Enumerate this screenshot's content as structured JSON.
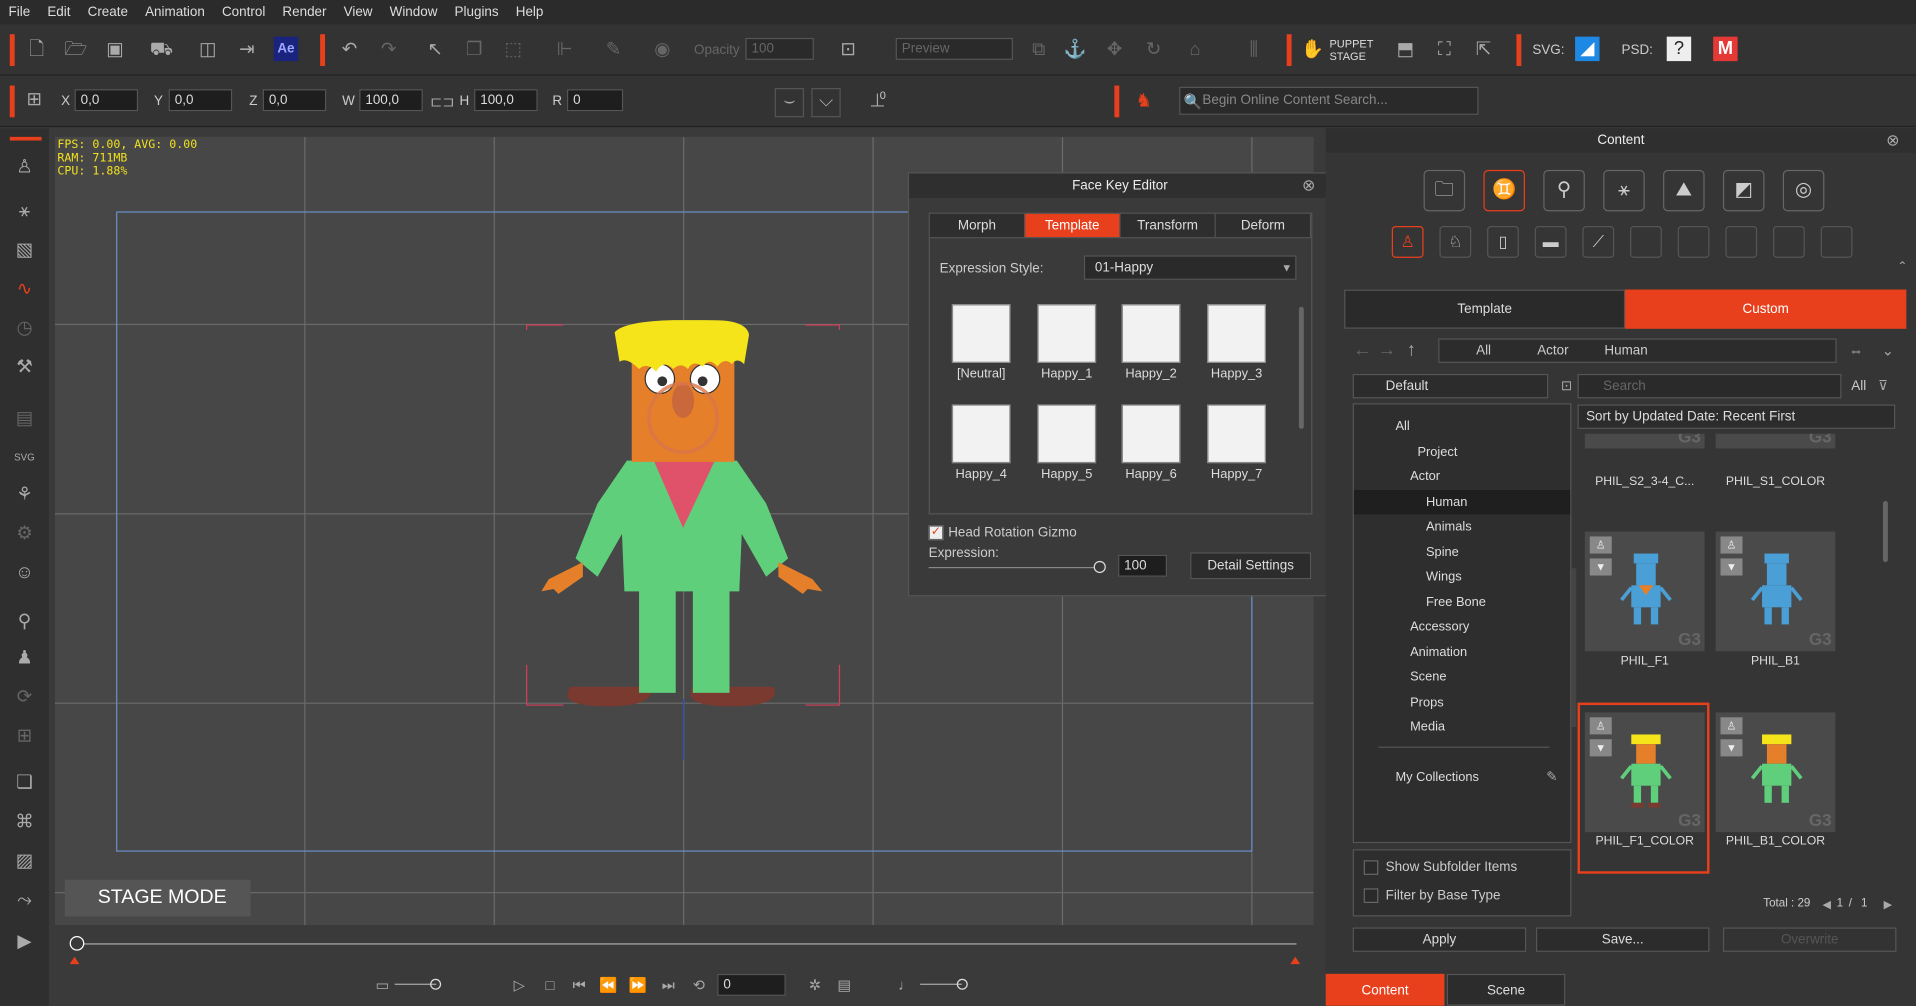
{
  "menu": [
    "File",
    "Edit",
    "Create",
    "Animation",
    "Control",
    "Render",
    "View",
    "Window",
    "Plugins",
    "Help"
  ],
  "toolbar": {
    "opacity_label": "Opacity",
    "opacity_value": "100",
    "preview_value": "Preview",
    "puppet_stage": "PUPPET STAGE",
    "svg_label": "SVG:",
    "psd_label": "PSD:",
    "ae_label": "Ae"
  },
  "transform": {
    "x_label": "X",
    "x_value": "0,0",
    "y_label": "Y",
    "y_value": "0,0",
    "z_label": "Z",
    "z_value": "0,0",
    "w_label": "W",
    "w_value": "100,0",
    "h_label": "H",
    "h_value": "100,0",
    "r_label": "R",
    "r_value": "0",
    "pivot_value": "0"
  },
  "search": {
    "placeholder": "Begin Online Content Search..."
  },
  "stats": {
    "fps": "FPS: 0.00, AVG: 0.00",
    "ram": "RAM: 711MB",
    "cpu": "CPU: 1.88%"
  },
  "stage_mode": "STAGE MODE",
  "timeline": {
    "frame": "0"
  },
  "face_key_editor": {
    "title": "Face Key Editor",
    "tabs": [
      "Morph",
      "Template",
      "Transform",
      "Deform"
    ],
    "active_tab": "Template",
    "expression_style_label": "Expression Style:",
    "expression_style_value": "01-Happy",
    "faces": [
      "[Neutral]",
      "Happy_1",
      "Happy_2",
      "Happy_3",
      "Happy_4",
      "Happy_5",
      "Happy_6",
      "Happy_7"
    ],
    "head_rotation_label": "Head Rotation Gizmo",
    "expression_label": "Expression:",
    "expression_value": "100",
    "detail_settings": "Detail Settings"
  },
  "content": {
    "title": "Content",
    "tab_template": "Template",
    "tab_custom": "Custom",
    "breadcrumb": [
      "All",
      "Actor",
      "Human"
    ],
    "filter_default": "Default",
    "search_placeholder": "Search",
    "search_all": "All",
    "sort": "Sort by Updated Date: Recent First",
    "tree": {
      "all": "All",
      "project": "Project",
      "actor": "Actor",
      "human": "Human",
      "animals": "Animals",
      "spine": "Spine",
      "wings": "Wings",
      "free_bone": "Free Bone",
      "accessory": "Accessory",
      "animation": "Animation",
      "scene": "Scene",
      "props": "Props",
      "media": "Media",
      "my_collections": "My Collections"
    },
    "tiles": [
      "PHIL_S2_3-4_C...",
      "PHIL_S1_COLOR",
      "PHIL_F1",
      "PHIL_B1",
      "PHIL_F1_COLOR",
      "PHIL_B1_COLOR"
    ],
    "g3": "G3",
    "show_subfolder": "Show Subfolder Items",
    "filter_base": "Filter by Base Type",
    "total": "Total : 29",
    "page_current": "1",
    "page_total": "1",
    "apply": "Apply",
    "save": "Save...",
    "overwrite": "Overwrite",
    "bottom_tabs": [
      "Content",
      "Scene"
    ]
  },
  "colors": {
    "accent": "#e8401c",
    "hair": "#f5e41a",
    "body": "#e57f2a",
    "suit": "#5fcf7c",
    "shirt": "#e0526a",
    "shoes": "#7a3a30"
  }
}
